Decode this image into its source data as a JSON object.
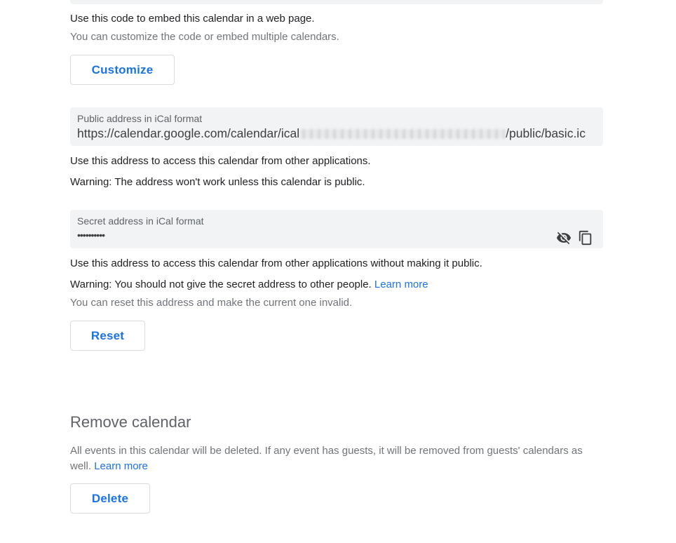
{
  "embed": {
    "description": "Use this code to embed this calendar in a web page.",
    "hint": "You can customize the code or embed multiple calendars.",
    "customize_label": "Customize"
  },
  "public_ical": {
    "label": "Public address in iCal format",
    "url_prefix": "https://calendar.google.com/calendar/ical",
    "url_suffix": "/public/basic.ic",
    "description": "Use this address to access this calendar from other applications.",
    "warning": "Warning: The address won't work unless this calendar is public."
  },
  "secret_ical": {
    "label": "Secret address in iCal format",
    "masked_value": "••••••••••",
    "icons": [
      "visibility-off-icon",
      "copy-icon"
    ],
    "description": "Use this address to access this calendar from other applications without making it public.",
    "warning": "Warning: You should not give the secret address to other people.",
    "learn_more": "Learn more",
    "reset_hint": "You can reset this address and make the current one invalid.",
    "reset_label": "Reset"
  },
  "remove": {
    "title": "Remove calendar",
    "description_line1": "All events in this calendar will be deleted. If any event has guests, it will be removed from guests' calendars as",
    "description_line2": "well.",
    "learn_more": "Learn more",
    "delete_label": "Delete"
  },
  "colors": {
    "accent": "#1a73e8",
    "field_bg": "#f1f3f4",
    "text_primary": "#202124",
    "text_secondary": "#70757a"
  }
}
